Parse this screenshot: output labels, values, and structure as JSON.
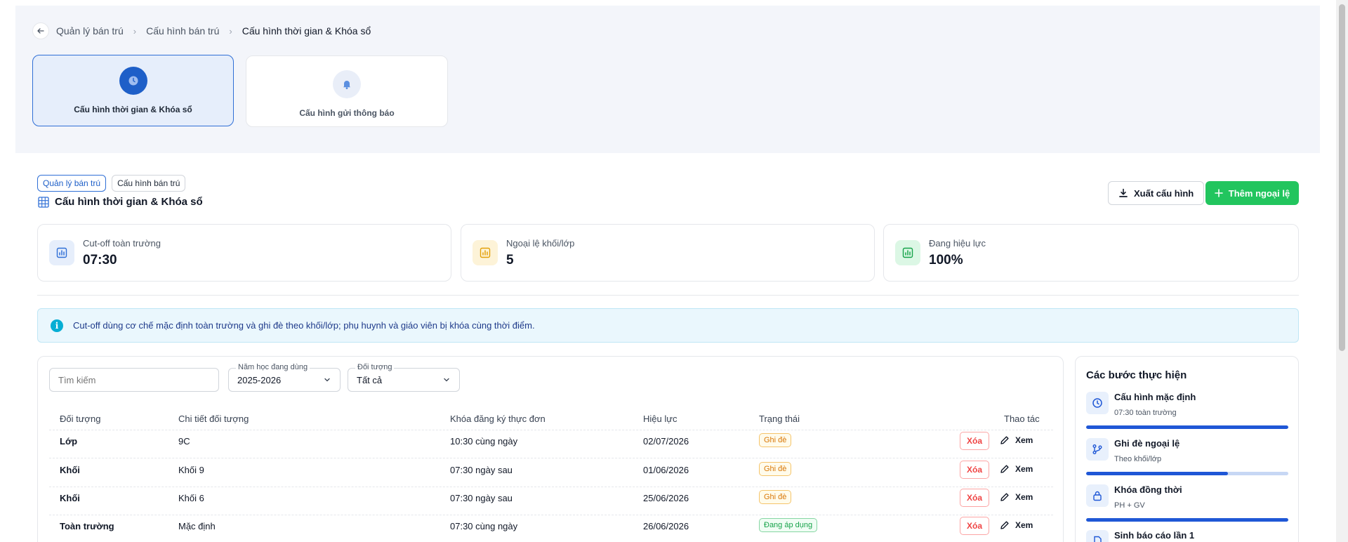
{
  "breadcrumb": {
    "items": [
      "Quản lý bán trú",
      "Cấu hình bán trú",
      "Cấu hình thời gian & Khóa sổ"
    ]
  },
  "config_cards": [
    {
      "label": "Cấu hình thời gian & Khóa sổ",
      "icon": "clock-icon",
      "active": true
    },
    {
      "label": "Cấu hình gửi thông báo",
      "icon": "bell-icon",
      "active": false
    }
  ],
  "header": {
    "tags": [
      "Quản lý bán trú",
      "Cấu hình bán trú"
    ],
    "title": "Cấu hình thời gian & Khóa sổ",
    "export_label": "Xuất cấu hình",
    "add_label": "Thêm ngoại lệ"
  },
  "stats": [
    {
      "label": "Cut-off toàn trường",
      "value": "07:30",
      "color": "#2f6fd6"
    },
    {
      "label": "Ngoại lệ khối/lớp",
      "value": "5",
      "color": "#e3a008"
    },
    {
      "label": "Đang hiệu lực",
      "value": "100%",
      "color": "#16a34a"
    }
  ],
  "info": {
    "text": "Cut-off dùng cơ chế mặc định toàn trường và ghi đè theo khối/lớp; phụ huynh và giáo viên bị khóa cùng thời điểm."
  },
  "filters": {
    "search_placeholder": "Tìm kiếm",
    "year_label": "Năm học đang dùng",
    "year_value": "2025-2026",
    "target_label": "Đối tượng",
    "target_value": "Tất cả"
  },
  "table": {
    "columns": [
      "Đối tượng",
      "Chi tiết đối tượng",
      "Khóa đăng ký thực đơn",
      "Hiệu lực",
      "Trạng thái",
      "Thao tác"
    ],
    "rows": [
      {
        "target": "Lớp",
        "detail": "9C",
        "lock": "10:30 cùng ngày",
        "effective": "02/07/2026",
        "status": "Ghi đè",
        "status_type": "warn"
      },
      {
        "target": "Khối",
        "detail": "Khối 9",
        "lock": "07:30 ngày sau",
        "effective": "01/06/2026",
        "status": "Ghi đè",
        "status_type": "warn"
      },
      {
        "target": "Khối",
        "detail": "Khối 6",
        "lock": "07:30 ngày sau",
        "effective": "25/06/2026",
        "status": "Ghi đè",
        "status_type": "warn"
      },
      {
        "target": "Toàn trường",
        "detail": "Mặc định",
        "lock": "07:30 cùng ngày",
        "effective": "26/06/2026",
        "status": "Đang áp dụng",
        "status_type": "ok"
      }
    ],
    "delete_label": "Xóa",
    "view_label": "Xem"
  },
  "steps": {
    "title": "Các bước thực hiện",
    "items": [
      {
        "name": "Cấu hình mặc định",
        "sub": "07:30 toàn trường",
        "icon": "clock-icon",
        "progress": 1.0
      },
      {
        "name": "Ghi đè ngoại lệ",
        "sub": "Theo khối/lớp",
        "icon": "branch-icon",
        "progress": 0.7
      },
      {
        "name": "Khóa đồng thời",
        "sub": "PH + GV",
        "icon": "lock-icon",
        "progress": 1.0
      },
      {
        "name": "Sinh báo cáo lần 1",
        "sub": "",
        "icon": "report-icon",
        "progress": 0.0
      }
    ]
  },
  "colors": {
    "primary": "#1e5fc8",
    "success": "#22c55e",
    "danger": "#ef4444",
    "warning": "#d97706"
  }
}
